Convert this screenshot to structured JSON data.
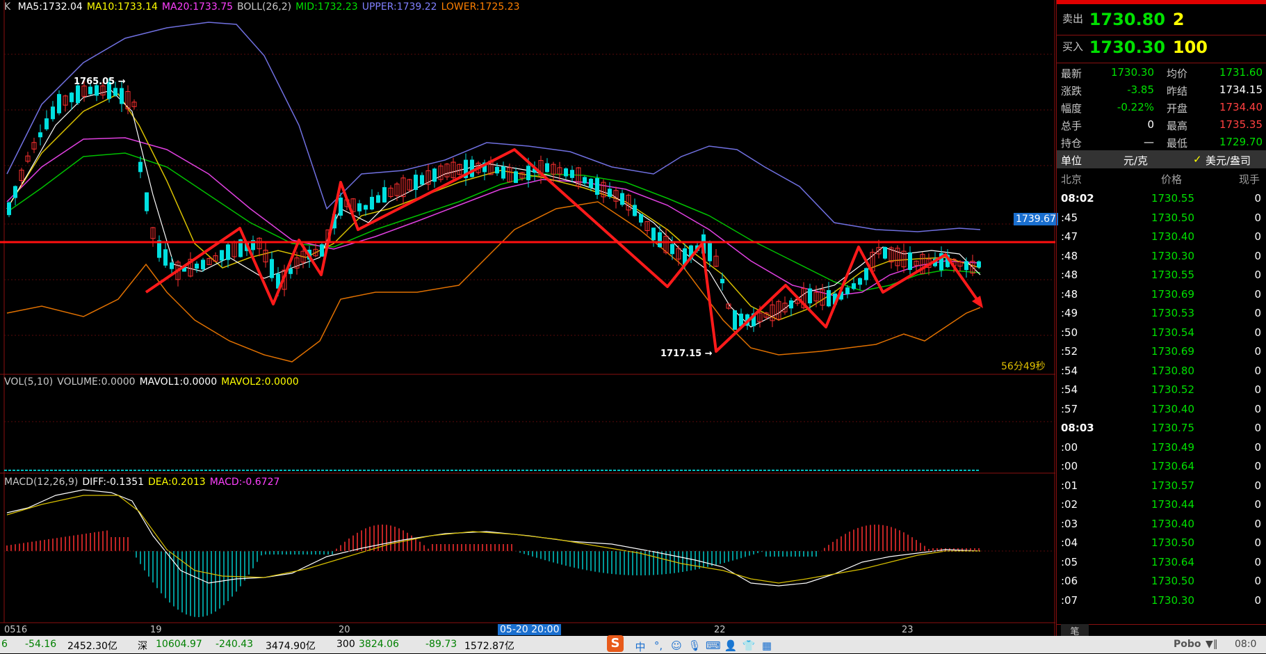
{
  "chart": {
    "symbol_prefix": "K",
    "ma_legend": [
      {
        "text": "MA5:1732.04",
        "color": "#ffffff"
      },
      {
        "text": "MA10:1733.14",
        "color": "#ffff00"
      },
      {
        "text": "MA20:1733.75",
        "color": "#ff40ff"
      },
      {
        "text": "BOLL(26,2)",
        "color": "#c8c8c8"
      },
      {
        "text": "MID:1732.23",
        "color": "#00e000"
      },
      {
        "text": "UPPER:1739.22",
        "color": "#8080ff"
      },
      {
        "text": "LOWER:1725.23",
        "color": "#ff8000"
      }
    ],
    "high_marker": "1765.05",
    "low_marker": "1717.15",
    "price_tag": "1739.67",
    "countdown": "56分49秒",
    "vol_legend": [
      {
        "text": "VOL(5,10)",
        "color": "#c8c8c8"
      },
      {
        "text": "VOLUME:0.0000",
        "color": "#c8c8c8"
      },
      {
        "text": "MAVOL1:0.0000",
        "color": "#ffffff"
      },
      {
        "text": "MAVOL2:0.0000",
        "color": "#ffff00"
      }
    ],
    "macd_legend": [
      {
        "text": "MACD(12,26,9)",
        "color": "#c8c8c8"
      },
      {
        "text": "DIFF:-0.1351",
        "color": "#ffffff"
      },
      {
        "text": "DEA:0.2013",
        "color": "#ffff00"
      },
      {
        "text": "MACD:-0.6727",
        "color": "#ff40ff"
      }
    ],
    "x_labels": [
      "0516",
      "19",
      "20",
      "22",
      "23"
    ],
    "cursor_time": "05-20 20:00"
  },
  "chart_data": {
    "type": "candlestick",
    "x_labels": [
      "0516",
      "19",
      "20",
      "22",
      "23"
    ],
    "support_line": 1739.67,
    "high": 1765.05,
    "low": 1717.15
  },
  "quote": {
    "sell_label": "卖出",
    "sell_price": "1730.80",
    "sell_qty": "2",
    "buy_label": "买入",
    "buy_price": "1730.30",
    "buy_qty": "100",
    "stats": [
      {
        "l1": "最新",
        "v1": "1730.30",
        "c1": "#00e000",
        "l2": "均价",
        "v2": "1731.60",
        "c2": "#00e000"
      },
      {
        "l1": "涨跌",
        "v1": "-3.85",
        "c1": "#00e000",
        "l2": "昨结",
        "v2": "1734.15",
        "c2": "#ffffff"
      },
      {
        "l1": "幅度",
        "v1": "-0.22%",
        "c1": "#00e000",
        "l2": "开盘",
        "v2": "1734.40",
        "c2": "#ff4040"
      },
      {
        "l1": "总手",
        "v1": "0",
        "c1": "#ffffff",
        "l2": "最高",
        "v2": "1735.35",
        "c2": "#ff4040"
      },
      {
        "l1": "持仓",
        "v1": "—",
        "c1": "#ffffff",
        "l2": "最低",
        "v2": "1729.70",
        "c2": "#00e000"
      }
    ],
    "unit_label": "单位",
    "unit_value": "元/克",
    "unit_alt": "美元/盎司",
    "col_time": "北京",
    "col_price": "价格",
    "col_qty": "现手",
    "ticks": [
      {
        "t": "08:02",
        "p": "1730.55",
        "q": "0",
        "bold": true
      },
      {
        "t": ":45",
        "p": "1730.50",
        "q": "0"
      },
      {
        "t": ":47",
        "p": "1730.40",
        "q": "0"
      },
      {
        "t": ":48",
        "p": "1730.30",
        "q": "0"
      },
      {
        "t": ":48",
        "p": "1730.55",
        "q": "0"
      },
      {
        "t": ":48",
        "p": "1730.69",
        "q": "0"
      },
      {
        "t": ":49",
        "p": "1730.53",
        "q": "0"
      },
      {
        "t": ":50",
        "p": "1730.54",
        "q": "0"
      },
      {
        "t": ":52",
        "p": "1730.69",
        "q": "0"
      },
      {
        "t": ":54",
        "p": "1730.80",
        "q": "0"
      },
      {
        "t": ":54",
        "p": "1730.52",
        "q": "0"
      },
      {
        "t": ":57",
        "p": "1730.40",
        "q": "0"
      },
      {
        "t": "08:03",
        "p": "1730.75",
        "q": "0",
        "bold": true
      },
      {
        "t": ":00",
        "p": "1730.49",
        "q": "0"
      },
      {
        "t": ":00",
        "p": "1730.64",
        "q": "0"
      },
      {
        "t": ":01",
        "p": "1730.57",
        "q": "0"
      },
      {
        "t": ":02",
        "p": "1730.44",
        "q": "0"
      },
      {
        "t": ":03",
        "p": "1730.40",
        "q": "0"
      },
      {
        "t": ":04",
        "p": "1730.50",
        "q": "0"
      },
      {
        "t": ":05",
        "p": "1730.64",
        "q": "0"
      },
      {
        "t": ":06",
        "p": "1730.50",
        "q": "0"
      },
      {
        "t": ":07",
        "p": "1730.30",
        "q": "0"
      }
    ],
    "tab_label": "笔"
  },
  "bottom_bar": {
    "items": [
      {
        "text": "6",
        "color": "#008000"
      },
      {
        "text": "-54.16",
        "color": "#008000"
      },
      {
        "text": "2452.30亿",
        "color": "#000000"
      },
      {
        "text": "深",
        "color": "#000000"
      },
      {
        "text": "10604.97",
        "color": "#008000"
      },
      {
        "text": "-240.43",
        "color": "#008000"
      },
      {
        "text": "3474.90亿",
        "color": "#000000"
      },
      {
        "text": "300",
        "color": "#000000"
      },
      {
        "text": "3824.06",
        "color": "#008000"
      },
      {
        "text": "-89.73",
        "color": "#008000"
      },
      {
        "text": "1572.87亿",
        "color": "#000000"
      }
    ],
    "ime_logo": "S",
    "ime_lang": "中",
    "brand": "Pobo",
    "clock": "08:0"
  }
}
